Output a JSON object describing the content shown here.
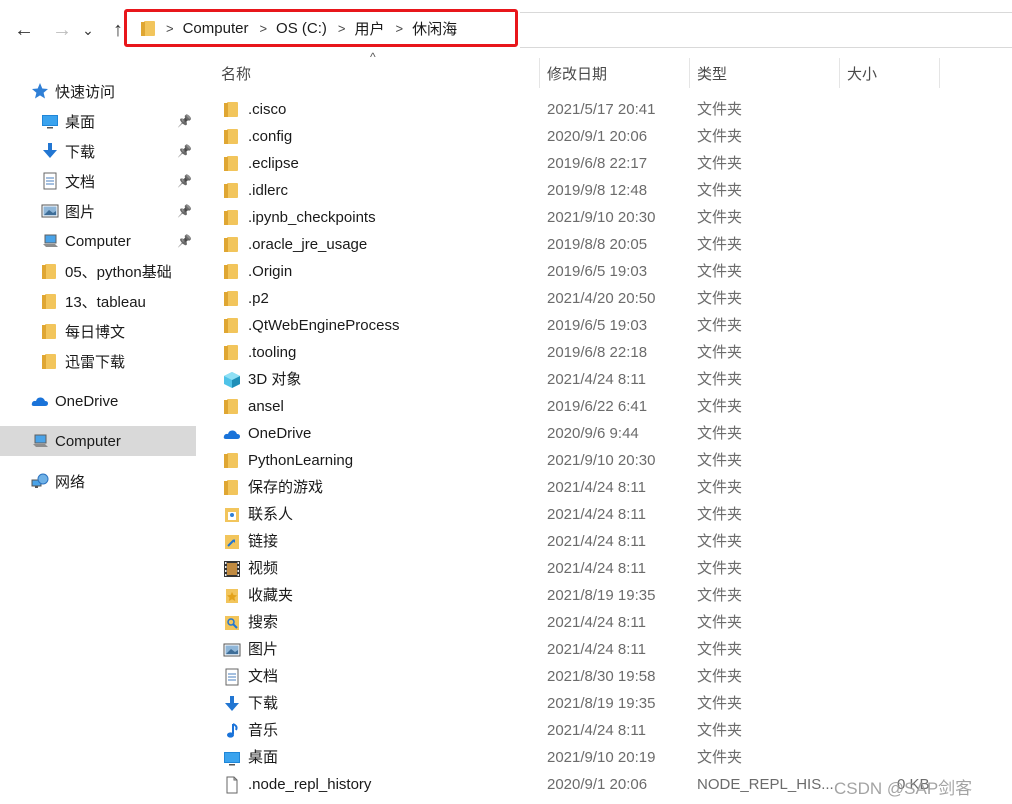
{
  "breadcrumb": [
    "Computer",
    "OS (C:)",
    "用户",
    "休闲海"
  ],
  "nav": {
    "back": "←",
    "forward": "→",
    "recent": "⌄",
    "up": "↑"
  },
  "sidebar": [
    {
      "label": "快速访问",
      "icon": "star-icon",
      "pinned": false,
      "indent": 1
    },
    {
      "label": "桌面",
      "icon": "desktop-icon",
      "pinned": true,
      "indent": 2
    },
    {
      "label": "下载",
      "icon": "download-icon",
      "pinned": true,
      "indent": 2
    },
    {
      "label": "文档",
      "icon": "document-icon",
      "pinned": true,
      "indent": 2
    },
    {
      "label": "图片",
      "icon": "picture-icon",
      "pinned": true,
      "indent": 2
    },
    {
      "label": "Computer",
      "icon": "computer-icon",
      "pinned": true,
      "indent": 2
    },
    {
      "label": "05、python基础",
      "icon": "folder-icon",
      "pinned": false,
      "indent": 2
    },
    {
      "label": "13、tableau",
      "icon": "folder-icon",
      "pinned": false,
      "indent": 2
    },
    {
      "label": "每日博文",
      "icon": "folder-icon",
      "pinned": false,
      "indent": 2
    },
    {
      "label": "迅雷下载",
      "icon": "folder-icon",
      "pinned": false,
      "indent": 2
    },
    {
      "label": "OneDrive",
      "icon": "onedrive-icon",
      "pinned": false,
      "indent": 0
    },
    {
      "label": "Computer",
      "icon": "computer-icon",
      "pinned": false,
      "indent": 0,
      "selected": true
    },
    {
      "label": "网络",
      "icon": "network-icon",
      "pinned": false,
      "indent": 0
    }
  ],
  "columns": {
    "name": "名称",
    "date": "修改日期",
    "type": "类型",
    "size": "大小"
  },
  "files": [
    {
      "name": ".cisco",
      "date": "2021/5/17 20:41",
      "type": "文件夹",
      "size": "",
      "icon": "folder-icon"
    },
    {
      "name": ".config",
      "date": "2020/9/1 20:06",
      "type": "文件夹",
      "size": "",
      "icon": "folder-icon"
    },
    {
      "name": ".eclipse",
      "date": "2019/6/8 22:17",
      "type": "文件夹",
      "size": "",
      "icon": "folder-icon"
    },
    {
      "name": ".idlerc",
      "date": "2019/9/8 12:48",
      "type": "文件夹",
      "size": "",
      "icon": "folder-icon"
    },
    {
      "name": ".ipynb_checkpoints",
      "date": "2021/9/10 20:30",
      "type": "文件夹",
      "size": "",
      "icon": "folder-icon"
    },
    {
      "name": ".oracle_jre_usage",
      "date": "2019/8/8 20:05",
      "type": "文件夹",
      "size": "",
      "icon": "folder-icon"
    },
    {
      "name": ".Origin",
      "date": "2019/6/5 19:03",
      "type": "文件夹",
      "size": "",
      "icon": "folder-icon"
    },
    {
      "name": ".p2",
      "date": "2021/4/20 20:50",
      "type": "文件夹",
      "size": "",
      "icon": "folder-icon"
    },
    {
      "name": ".QtWebEngineProcess",
      "date": "2019/6/5 19:03",
      "type": "文件夹",
      "size": "",
      "icon": "folder-icon"
    },
    {
      "name": ".tooling",
      "date": "2019/6/8 22:18",
      "type": "文件夹",
      "size": "",
      "icon": "folder-icon"
    },
    {
      "name": "3D 对象",
      "date": "2021/4/24 8:11",
      "type": "文件夹",
      "size": "",
      "icon": "3d-objects-icon"
    },
    {
      "name": "ansel",
      "date": "2019/6/22 6:41",
      "type": "文件夹",
      "size": "",
      "icon": "folder-icon"
    },
    {
      "name": "OneDrive",
      "date": "2020/9/6 9:44",
      "type": "文件夹",
      "size": "",
      "icon": "onedrive-icon"
    },
    {
      "name": "PythonLearning",
      "date": "2021/9/10 20:30",
      "type": "文件夹",
      "size": "",
      "icon": "folder-icon"
    },
    {
      "name": "保存的游戏",
      "date": "2021/4/24 8:11",
      "type": "文件夹",
      "size": "",
      "icon": "saved-games-icon"
    },
    {
      "name": "联系人",
      "date": "2021/4/24 8:11",
      "type": "文件夹",
      "size": "",
      "icon": "contacts-icon"
    },
    {
      "name": "链接",
      "date": "2021/4/24 8:11",
      "type": "文件夹",
      "size": "",
      "icon": "links-icon"
    },
    {
      "name": "视频",
      "date": "2021/4/24 8:11",
      "type": "文件夹",
      "size": "",
      "icon": "videos-icon"
    },
    {
      "name": "收藏夹",
      "date": "2021/8/19 19:35",
      "type": "文件夹",
      "size": "",
      "icon": "favorites-icon"
    },
    {
      "name": "搜索",
      "date": "2021/4/24 8:11",
      "type": "文件夹",
      "size": "",
      "icon": "searches-icon"
    },
    {
      "name": "图片",
      "date": "2021/4/24 8:11",
      "type": "文件夹",
      "size": "",
      "icon": "picture-icon"
    },
    {
      "name": "文档",
      "date": "2021/8/30 19:58",
      "type": "文件夹",
      "size": "",
      "icon": "document-icon"
    },
    {
      "name": "下载",
      "date": "2021/8/19 19:35",
      "type": "文件夹",
      "size": "",
      "icon": "download-icon"
    },
    {
      "name": "音乐",
      "date": "2021/4/24 8:11",
      "type": "文件夹",
      "size": "",
      "icon": "music-icon"
    },
    {
      "name": "桌面",
      "date": "2021/9/10 20:19",
      "type": "文件夹",
      "size": "",
      "icon": "desktop-icon"
    },
    {
      "name": ".node_repl_history",
      "date": "2020/9/1 20:06",
      "type": "NODE_REPL_HIS...",
      "size": "0 KB",
      "icon": "file-icon"
    }
  ],
  "watermark": "CSDN @SAP剑客",
  "colors": {
    "highlight_border": "#e8161b",
    "folder": "#f2c55c",
    "selected_bg": "#d9d9d9",
    "accent_blue": "#1a73d9"
  }
}
